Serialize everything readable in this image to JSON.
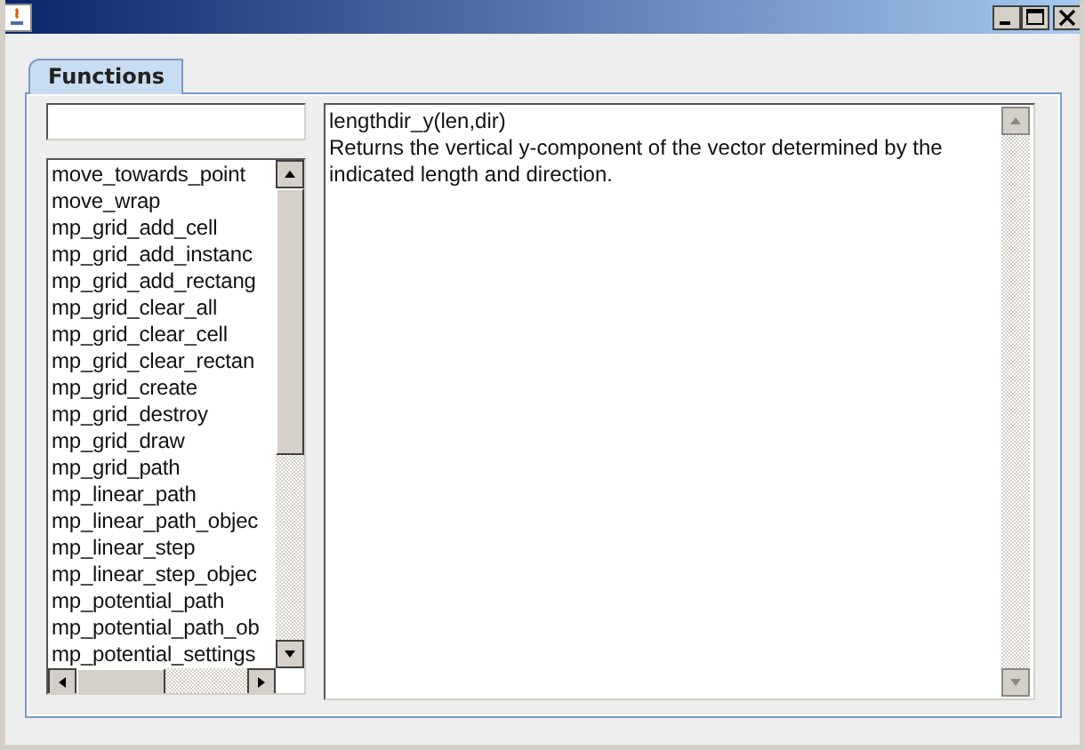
{
  "tabs": [
    {
      "label": "Functions",
      "selected": true
    }
  ],
  "functions": [
    {
      "name": "move_towards_point",
      "selected": false
    },
    {
      "name": "move_wrap",
      "selected": false
    },
    {
      "name": "mp_grid_add_cell",
      "selected": false
    },
    {
      "name": "mp_grid_add_instanc",
      "selected": false
    },
    {
      "name": "mp_grid_add_rectang",
      "selected": false
    },
    {
      "name": "mp_grid_clear_all",
      "selected": false
    },
    {
      "name": "mp_grid_clear_cell",
      "selected": false
    },
    {
      "name": "mp_grid_clear_rectan",
      "selected": false
    },
    {
      "name": "mp_grid_create",
      "selected": false
    },
    {
      "name": "mp_grid_destroy",
      "selected": false
    },
    {
      "name": "mp_grid_draw",
      "selected": false
    },
    {
      "name": "mp_grid_path",
      "selected": false
    },
    {
      "name": "mp_linear_path",
      "selected": false
    },
    {
      "name": "mp_linear_path_objec",
      "selected": false
    },
    {
      "name": "mp_linear_step",
      "selected": false
    },
    {
      "name": "mp_linear_step_objec",
      "selected": false
    },
    {
      "name": "mp_potential_path",
      "selected": false
    },
    {
      "name": "mp_potential_path_ob",
      "selected": false
    },
    {
      "name": "mp_potential_settings",
      "selected": false
    }
  ],
  "description": {
    "signature": "lengthdir_y(len,dir)",
    "text": "Returns the vertical y-component of the vector determined by the indicated length and direction."
  }
}
